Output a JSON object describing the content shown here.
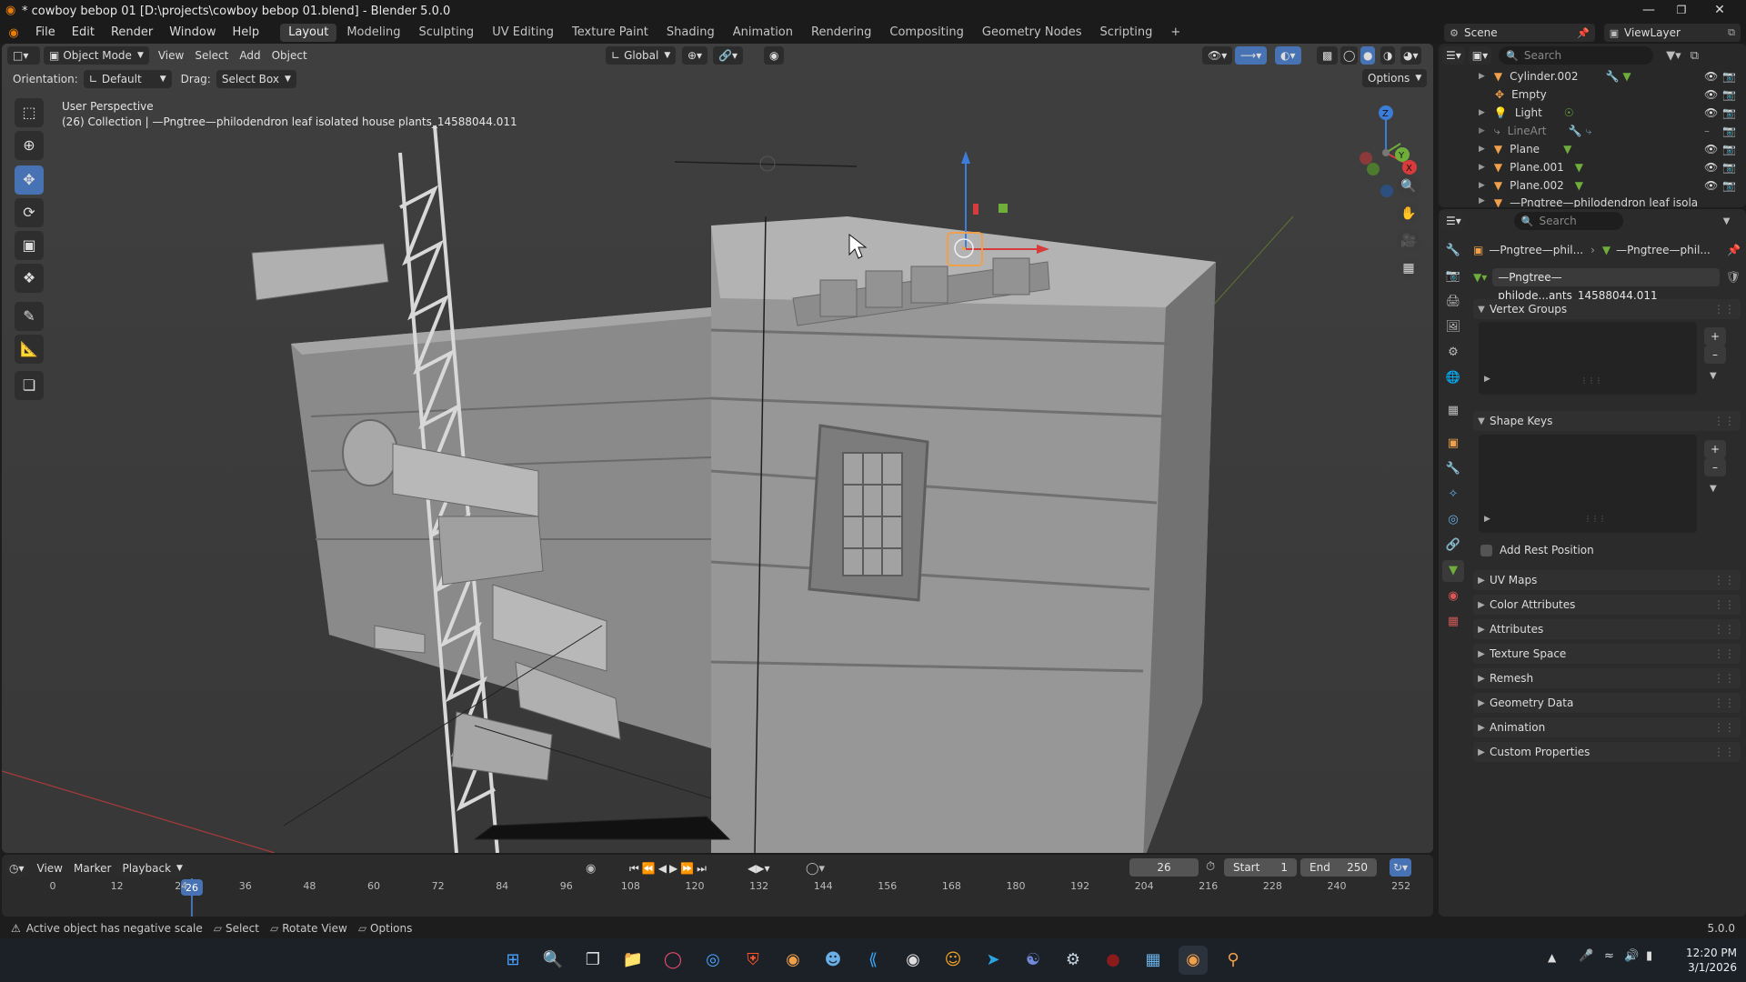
{
  "window": {
    "title": "* cowboy bebop 01 [D:\\projects\\cowboy bebop 01.blend] - Blender 5.0.0",
    "minimize": "—",
    "maximize": "❐",
    "close": "✕"
  },
  "menu": {
    "items": [
      "File",
      "Edit",
      "Render",
      "Window",
      "Help"
    ],
    "workspaces": [
      "Layout",
      "Modeling",
      "Sculpting",
      "UV Editing",
      "Texture Paint",
      "Shading",
      "Animation",
      "Rendering",
      "Compositing",
      "Geometry Nodes",
      "Scripting"
    ],
    "active_workspace": "Layout",
    "add_tab": "+"
  },
  "scene": {
    "label": "Scene",
    "view_layer": "ViewLayer"
  },
  "viewport": {
    "mode": "Object Mode",
    "view": "View",
    "select": "Select",
    "add": "Add",
    "object": "Object",
    "transform_orientation": "Global",
    "orientation_label": "Orientation:",
    "orientation_value": "Default",
    "drag_label": "Drag:",
    "drag_value": "Select Box",
    "options": "Options",
    "perspective": "User Perspective",
    "collection_info": "(26) Collection | —Pngtree—philodendron leaf isolated house plants_14588044.011",
    "axes": {
      "x": "X",
      "y": "Y",
      "z": "Z"
    }
  },
  "outliner": {
    "search_placeholder": "Search",
    "items": [
      {
        "name": "Cylinder.002",
        "type": "mesh"
      },
      {
        "name": "Empty",
        "type": "empty"
      },
      {
        "name": "Light",
        "type": "light"
      },
      {
        "name": "LineArt",
        "type": "gpencil"
      },
      {
        "name": "Plane",
        "type": "mesh"
      },
      {
        "name": "Plane.001",
        "type": "mesh"
      },
      {
        "name": "Plane.002",
        "type": "mesh"
      },
      {
        "name": "—Pngtree—philodendron leaf isola",
        "type": "mesh"
      }
    ]
  },
  "properties": {
    "search_placeholder": "Search",
    "breadcrumb_object": "—Pngtree—phil...",
    "breadcrumb_data": "—Pngtree—phil...",
    "datablock_name": "—Pngtree—philode...ants_14588044.011",
    "panels": {
      "vertex_groups": "Vertex Groups",
      "shape_keys": "Shape Keys",
      "add_rest_position": "Add Rest Position",
      "collapsed": [
        "UV Maps",
        "Color Attributes",
        "Attributes",
        "Texture Space",
        "Remesh",
        "Geometry Data",
        "Animation",
        "Custom Properties"
      ]
    }
  },
  "timeline": {
    "view": "View",
    "marker": "Marker",
    "playback": "Playback",
    "current_frame": "26",
    "start_label": "Start",
    "start_value": "1",
    "end_label": "End",
    "end_value": "250",
    "ruler": [
      "0",
      "12",
      "24",
      "36",
      "48",
      "60",
      "72",
      "84",
      "96",
      "108",
      "120",
      "132",
      "144",
      "156",
      "168",
      "180",
      "192",
      "204",
      "216",
      "228",
      "240",
      "252"
    ]
  },
  "status": {
    "warning": "Active object has negative scale",
    "select": "Select",
    "rotate": "Rotate View",
    "options": "Options",
    "version": "5.0.0"
  },
  "taskbar": {
    "time": "12:20 PM",
    "date": "3/1/2026"
  },
  "colors": {
    "accent": "#4772b3",
    "viewport_bg": "#3d3d3d",
    "panel_bg": "#2b2b2b",
    "header_bg": "#1b1b1b",
    "selection_orange": "#f0a04a"
  }
}
